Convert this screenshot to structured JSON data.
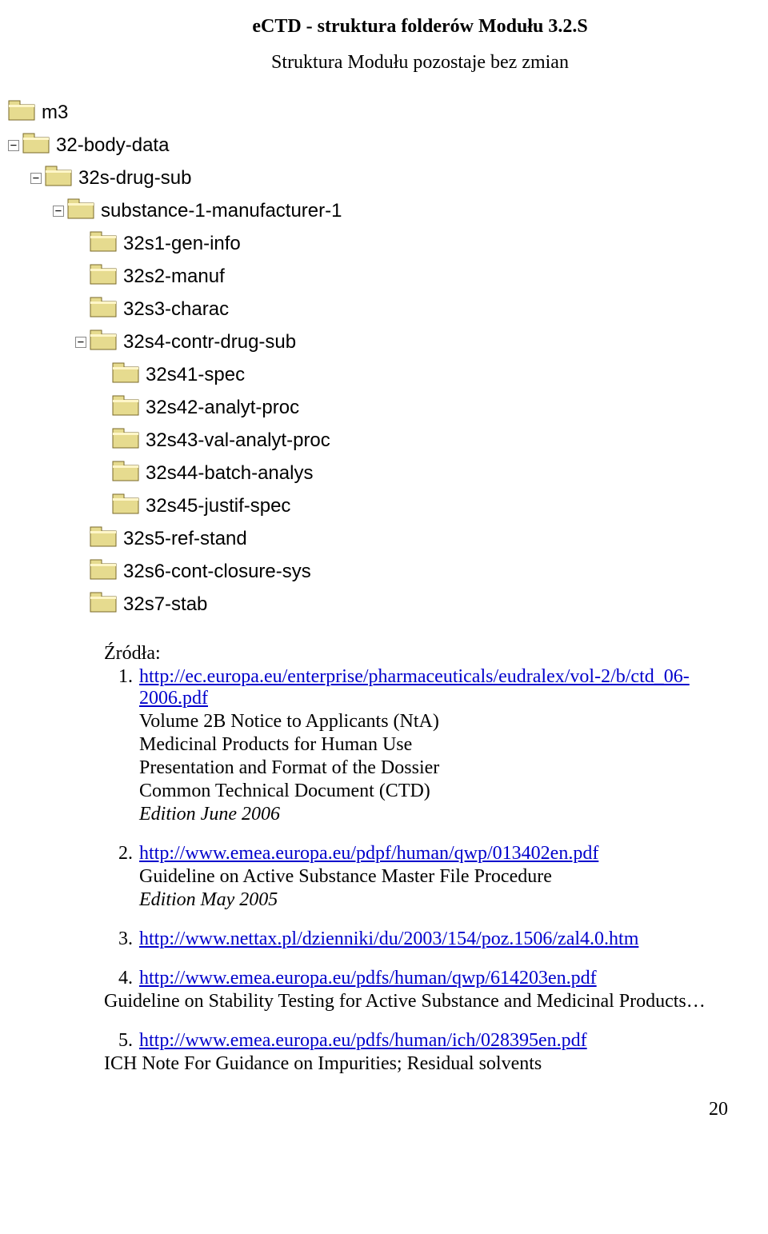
{
  "header": {
    "title": "eCTD - struktura folderów Modułu 3.2.S",
    "subtitle": "Struktura Modułu pozostaje bez zmian"
  },
  "tree": [
    {
      "indent": 0,
      "expander": "",
      "label": "m3"
    },
    {
      "indent": 0,
      "expander": "-",
      "label": "32-body-data"
    },
    {
      "indent": 1,
      "expander": "-",
      "label": "32s-drug-sub"
    },
    {
      "indent": 2,
      "expander": "-",
      "label": "substance-1-manufacturer-1"
    },
    {
      "indent": 3,
      "expander": "",
      "label": "32s1-gen-info"
    },
    {
      "indent": 3,
      "expander": "",
      "label": "32s2-manuf"
    },
    {
      "indent": 3,
      "expander": "",
      "label": "32s3-charac"
    },
    {
      "indent": 3,
      "expander": "-",
      "label": "32s4-contr-drug-sub"
    },
    {
      "indent": 4,
      "expander": "",
      "label": "32s41-spec"
    },
    {
      "indent": 4,
      "expander": "",
      "label": "32s42-analyt-proc"
    },
    {
      "indent": 4,
      "expander": "",
      "label": "32s43-val-analyt-proc"
    },
    {
      "indent": 4,
      "expander": "",
      "label": "32s44-batch-analys"
    },
    {
      "indent": 4,
      "expander": "",
      "label": "32s45-justif-spec"
    },
    {
      "indent": 3,
      "expander": "",
      "label": "32s5-ref-stand"
    },
    {
      "indent": 3,
      "expander": "",
      "label": "32s6-cont-closure-sys"
    },
    {
      "indent": 3,
      "expander": "",
      "label": "32s7-stab"
    }
  ],
  "sources": {
    "heading": "Źródła:",
    "items": [
      {
        "num": "1.",
        "link": "http://ec.europa.eu/enterprise/pharmaceuticals/eudralex/vol-2/b/ctd_06-2006.pdf",
        "lines": [
          "Volume 2B Notice to Applicants        (NtA)",
          "Medicinal Products for Human Use",
          "Presentation and Format of the Dossier",
          "Common Technical Document (CTD)"
        ],
        "italicLine": "Edition June 2006"
      },
      {
        "num": "2.",
        "link": "http://www.emea.europa.eu/pdpf/human/qwp/013402en.pdf",
        "lines": [
          "Guideline on Active Substance Master File Procedure"
        ],
        "italicLine": "Edition May 2005"
      },
      {
        "num": "3.",
        "link": "http://www.nettax.pl/dzienniki/du/2003/154/poz.1506/zal4.0.htm"
      },
      {
        "num": "4.",
        "link": "http://www.emea.europa.eu/pdfs/human/qwp/614203en.pdf",
        "afterLines": [
          "Guideline on Stability Testing for Active Substance and Medicinal Products…"
        ]
      },
      {
        "num": "5.",
        "link": "http://www.emea.europa.eu/pdfs/human/ich/028395en.pdf",
        "afterLines": [
          "ICH Note For Guidance on Impurities; Residual solvents"
        ]
      }
    ]
  },
  "pageNumber": "20"
}
